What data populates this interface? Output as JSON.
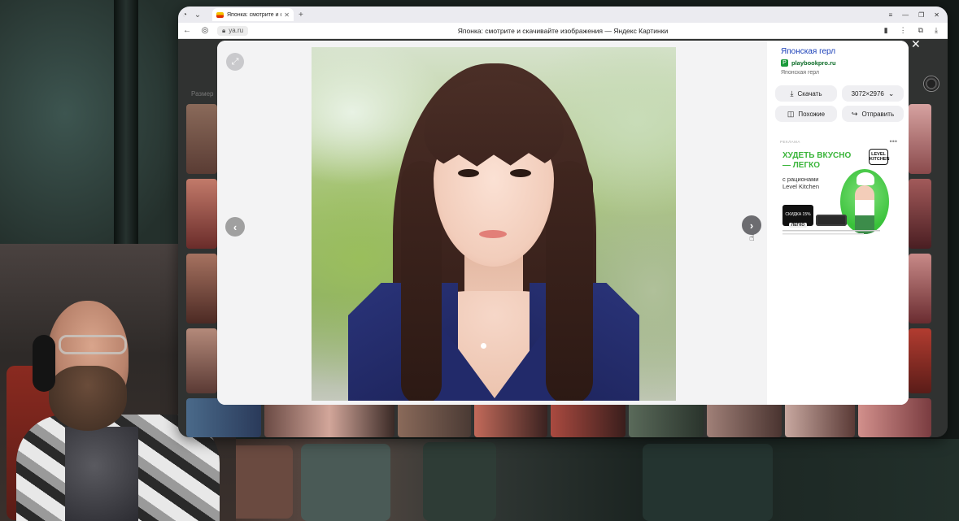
{
  "browser": {
    "tab_title": "Японка: смотрите и ск",
    "tab_close": "✕",
    "tab_new": "+",
    "url": "ya.ru",
    "page_title": "Японка: смотрите и скачивайте изображения — Яндекс Картинки",
    "page_size_label": "Размер"
  },
  "viewer": {
    "image_title": "Японская герл",
    "source_domain": "playbookpro.ru",
    "source_icon_letter": "P",
    "image_desc": "Японская герл",
    "download_label": "Скачать",
    "resolution_label": "3072×2976",
    "similar_label": "Похожие",
    "share_label": "Отправить",
    "close_glyph": "✕",
    "prev_glyph": "‹",
    "next_glyph": "›",
    "fullscreen_glyph": "⤢"
  },
  "ad": {
    "label": "РЕКЛАМА",
    "more": "•••",
    "headline": "ХУДЕТЬ ВКУСНО\n— ЛЕГКО",
    "subline": "с рационами\nLevel Kitchen",
    "logo": "LEVEL\nKITCHEN",
    "promo_top": "СКИДКА 15%",
    "promo_code": "ЛЕГКО"
  },
  "icons": {
    "download": "download-icon",
    "similar": "camera-search-icon",
    "share": "share-icon",
    "chevron": "chevron-down-icon"
  },
  "colors": {
    "link_blue": "#1a3fb8",
    "source_green": "#0b6b26",
    "ad_green": "#3ab53a"
  }
}
